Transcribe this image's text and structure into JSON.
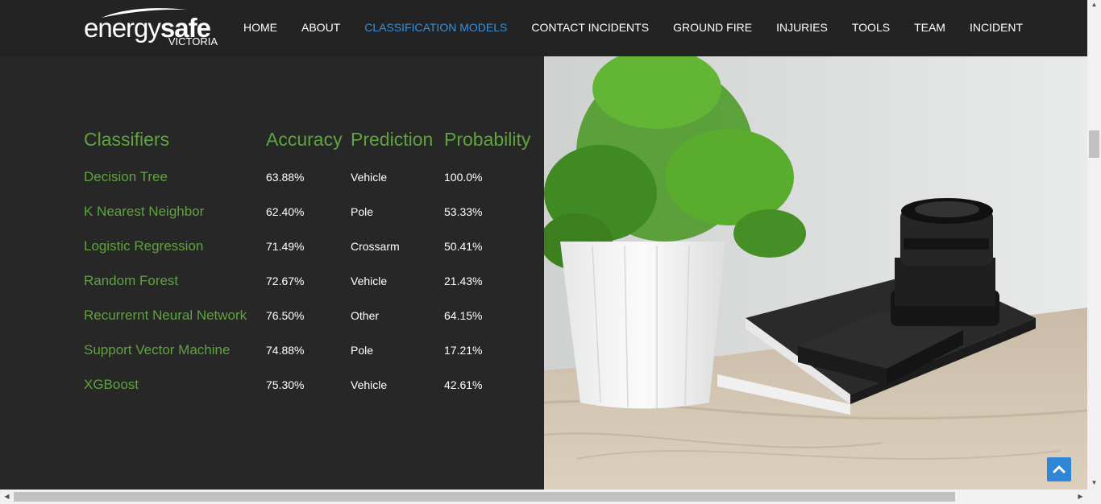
{
  "brand": {
    "name_light": "energy",
    "name_bold": "safe",
    "sub": "VICTORIA"
  },
  "nav": {
    "items": [
      {
        "label": "HOME"
      },
      {
        "label": "ABOUT"
      },
      {
        "label": "CLASSIFICATION MODELS",
        "active": true
      },
      {
        "label": "CONTACT INCIDENTS"
      },
      {
        "label": "GROUND FIRE"
      },
      {
        "label": "INJURIES"
      },
      {
        "label": "TOOLS"
      },
      {
        "label": "TEAM"
      },
      {
        "label": "INCIDENT"
      }
    ],
    "active_color": "#3a8fd9"
  },
  "table": {
    "headers": {
      "classifiers": "Classifiers",
      "accuracy": "Accuracy",
      "prediction": "Prediction",
      "probability": "Probability"
    },
    "rows": [
      {
        "name": "Decision Tree",
        "accuracy": "63.88%",
        "prediction": "Vehicle",
        "probability": "100.0%"
      },
      {
        "name": "K Nearest Neighbor",
        "accuracy": "62.40%",
        "prediction": "Pole",
        "probability": "53.33%"
      },
      {
        "name": "Logistic Regression",
        "accuracy": "71.49%",
        "prediction": "Crossarm",
        "probability": "50.41%"
      },
      {
        "name": "Random Forest",
        "accuracy": "72.67%",
        "prediction": "Vehicle",
        "probability": "21.43%"
      },
      {
        "name": "Recurrernt Neural Network",
        "accuracy": "76.50%",
        "prediction": "Other",
        "probability": "64.15%"
      },
      {
        "name": "Support Vector Machine",
        "accuracy": "74.88%",
        "prediction": "Pole",
        "probability": "17.21%"
      },
      {
        "name": "XGBoost",
        "accuracy": "75.30%",
        "prediction": "Vehicle",
        "probability": "42.61%"
      }
    ],
    "accent_color": "#5fa33e"
  },
  "icons": {
    "back_to_top": "chevron-up-icon",
    "scroll_up": "arrow-up-icon",
    "scroll_down": "arrow-down-icon",
    "scroll_left": "arrow-left-icon",
    "scroll_right": "arrow-right-icon"
  }
}
